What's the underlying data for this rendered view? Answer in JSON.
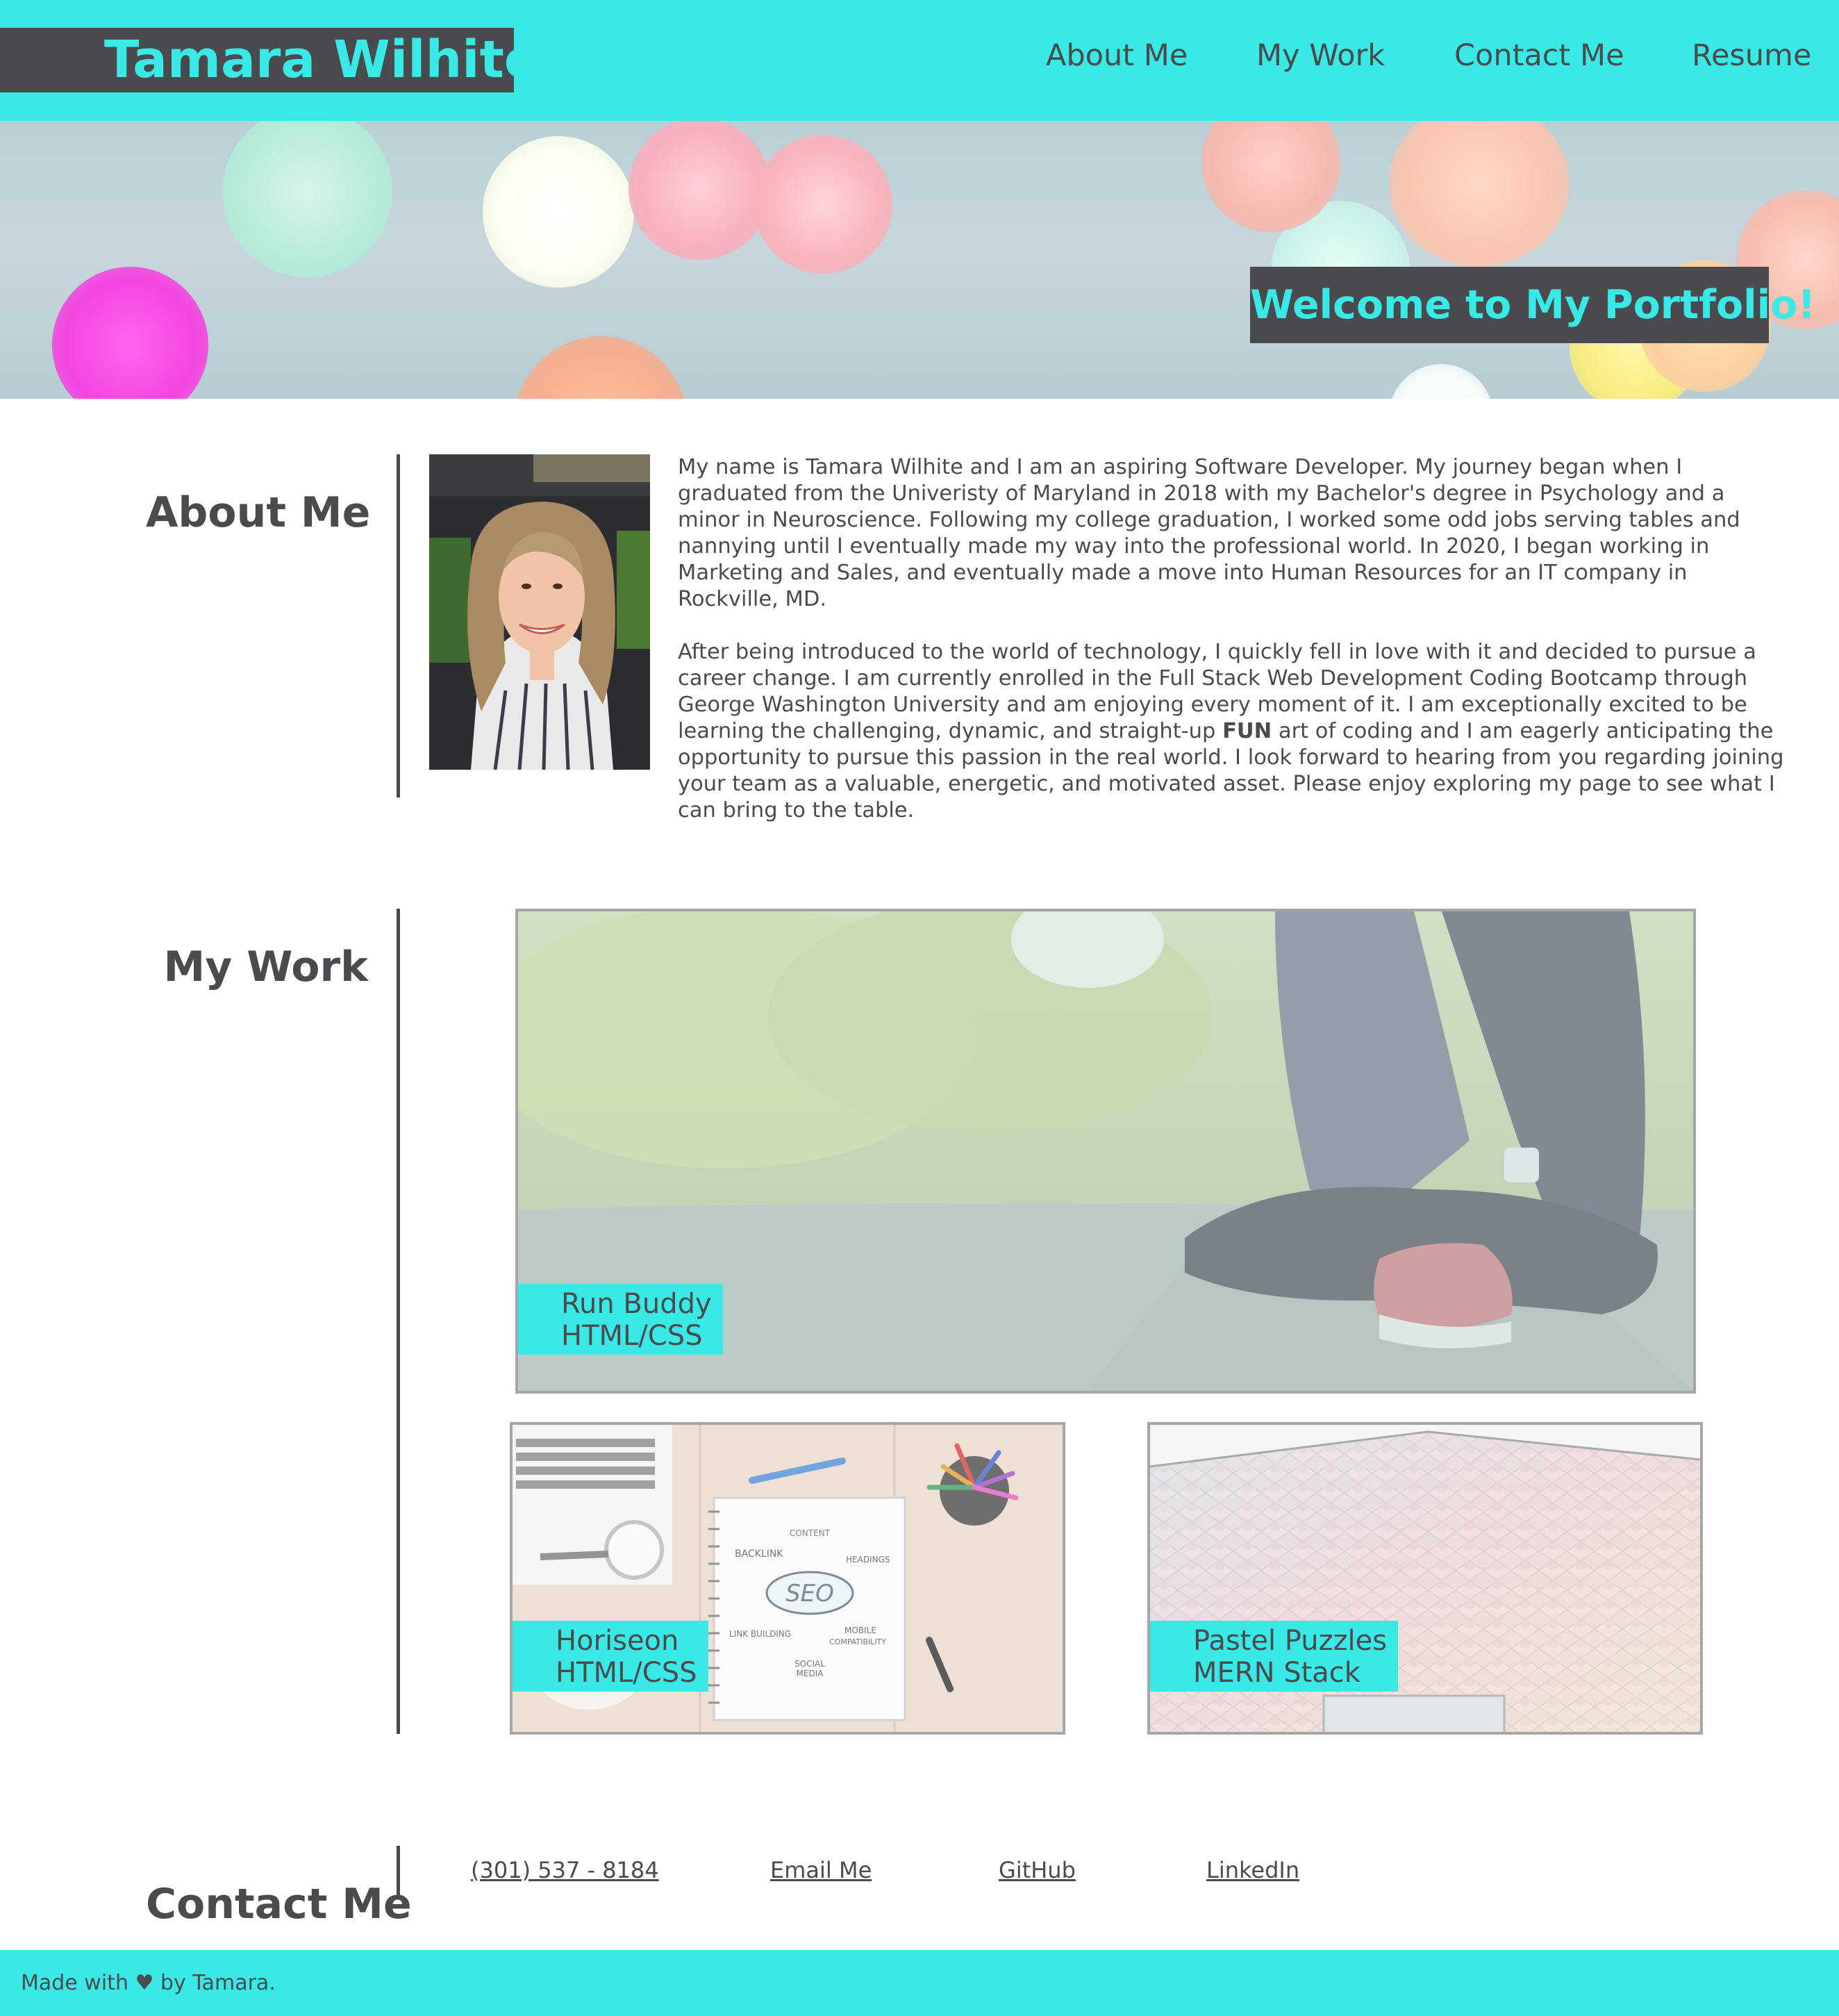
{
  "header": {
    "brand": "Tamara Wilhite",
    "nav": [
      "About Me",
      "My Work",
      "Contact Me",
      "Resume"
    ]
  },
  "hero": {
    "welcome": "Welcome to My Portfolio!"
  },
  "about": {
    "title": "About Me",
    "paragraph1": "My name is Tamara Wilhite and I am an aspiring Software Developer. My journey began when I graduated from the Univeristy of Maryland in 2018 with my Bachelor's degree in Psychology and a minor in Neuroscience. Following my college graduation, I worked some odd jobs serving tables and nannying until I eventually made my way into the professional world. In 2020, I began working in Marketing and Sales, and eventually made a move into Human Resources for an IT company in Rockville, MD.",
    "paragraph2_before": "After being introduced to the world of technology, I quickly fell in love with it and decided to pursue a career change. I am currently enrolled in the Full Stack Web Development Coding Bootcamp through George Washington University and am enjoying every moment of it. I am exceptionally excited to be learning the challenging, dynamic, and straight-up ",
    "paragraph2_bold": "FUN",
    "paragraph2_after": " art of coding and I am eagerly anticipating the opportunity to pursue this passion in the real world. I look forward to hearing from you regarding joining your team as a valuable, energetic, and motivated asset. Please enjoy exploring my page to see what I can bring to the table."
  },
  "work": {
    "title": "My Work",
    "projects": [
      {
        "name": "Run Buddy",
        "stack": "HTML/CSS"
      },
      {
        "name": "Horiseon",
        "stack": "HTML/CSS"
      },
      {
        "name": "Pastel Puzzles",
        "stack": "MERN Stack"
      }
    ],
    "seo_words": [
      "CONTENT",
      "BACKLINK",
      "HEADINGS",
      "SEO",
      "LINK BUILDING",
      "MOBILE",
      "COMPATIBILITY",
      "SOCIAL",
      "MEDIA"
    ]
  },
  "contact": {
    "title": "Contact Me",
    "links": [
      "(301) 537 - 8184",
      "Email Me",
      "GitHub",
      "LinkedIn"
    ]
  },
  "footer": {
    "text": "Made with ♥ by Tamara."
  },
  "colors": {
    "accent": "#39e9e5",
    "dark": "#4a4b4e",
    "border": "#a6a6a6"
  }
}
